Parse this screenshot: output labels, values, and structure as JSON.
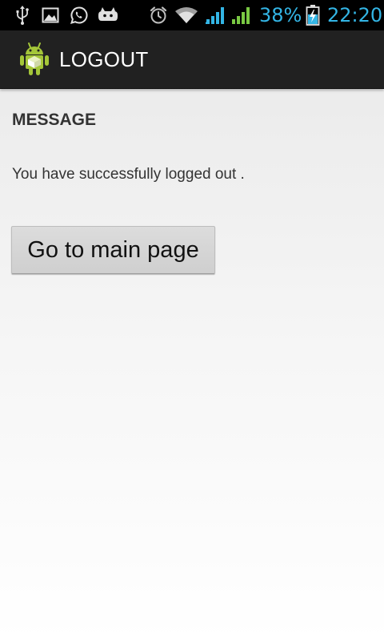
{
  "status_bar": {
    "left_icons": [
      "usb-icon",
      "gallery-icon",
      "whatsapp-icon",
      "game-controller-icon"
    ],
    "right_icons": [
      "alarm-icon",
      "wifi-icon",
      "signal-icon",
      "signal-icon",
      "battery-charging-icon"
    ],
    "battery_percent": "38%",
    "time": "22:20",
    "accent_color": "#33b5e5",
    "signal_colors": [
      "#33b5e5",
      "#7ac943"
    ]
  },
  "action_bar": {
    "title": "LOGOUT",
    "icon": "android-app-icon",
    "background": "#212121"
  },
  "content": {
    "section_header": "MESSAGE",
    "message": "You have successfully logged out .",
    "button_label": "Go to main page"
  }
}
